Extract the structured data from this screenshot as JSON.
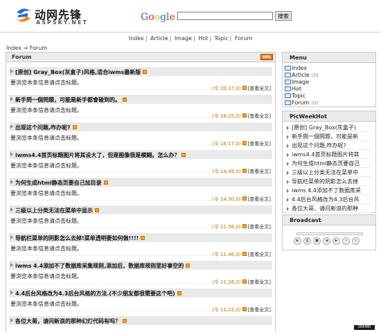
{
  "site": {
    "logo_cn": "动网先锋",
    "logo_en": "ASPSKY.NET"
  },
  "search": {
    "engine_label": "Google",
    "input_value": "",
    "button_label": "搜索"
  },
  "topnav": [
    "Index",
    "Article",
    "Image",
    "Hot",
    "Topic",
    "Forum"
  ],
  "breadcrumb": {
    "home": "Index",
    "arrow": "→",
    "current": "Forum"
  },
  "forum": {
    "title": "Forum",
    "xml_badge": "XML",
    "posts": [
      {
        "title": "[原创] Gray_Box(灰盒子)风格,适合iwms最新版",
        "body": "要浏览本条信息请点击标题。",
        "time": "(今 20:37,0)",
        "action": "[查看全文]"
      },
      {
        "title": "新手問一個問題，可能是新手都會碰到的。",
        "body": "要浏览本条信息请点击标题。",
        "time": "(今 16:25,0)",
        "action": "[查看全文]"
      },
      {
        "title": "出现这个问题,咋办呢?",
        "body": "要浏览本条信息请点击标题。",
        "time": "(今 16:17,0)",
        "action": "[查看全文]"
      },
      {
        "title": "iwms4.4首页标题图片将其设大了，但是图像很是模糊。怎么办？",
        "body": "要浏览本条信息请点击标题。",
        "time": "(今 14:49,0)",
        "action": "[查看全文]"
      },
      {
        "title": "为何生成html静态页要自己加目录",
        "body": "要浏览本条信息请点击标题。",
        "time": "(今 14:30,0)",
        "action": "[查看全文]"
      },
      {
        "title": "三级以上分类无法在菜单中显示",
        "body": "要浏览本条信息请点击标题。",
        "time": "(今 11:56,0)",
        "action": "[查看全文]"
      },
      {
        "title": "导航栏菜单的阴影怎么去掉!菜单透明要如何做!!!!",
        "body": "要浏览本条信息请点击标题。",
        "time": "(今 11:46,0)",
        "action": "[查看全文]"
      },
      {
        "title": "iwms 4.4添加不了数据库采集规则,添加后，数据库规则里好事空的",
        "body": "要浏览本条信息请点击标题。",
        "time": "(今 11:26,0)",
        "action": "[查看全文]"
      },
      {
        "title": "4.4后台风格改为4.3后台风格的方法.(不少朋友都很需要这个吧)",
        "body": "要浏览本条信息请点击标题。",
        "time": "(今 11:22,0)",
        "action": "[查看全文]"
      },
      {
        "title": "各位大哥，请问新浪的那种幻灯代码有吗？",
        "body": "",
        "time": "",
        "action": ""
      }
    ]
  },
  "menu": {
    "title": "Menu",
    "items": [
      {
        "label": "Index",
        "count": ""
      },
      {
        "label": "Article",
        "count": "(0)"
      },
      {
        "label": "Image",
        "count": ""
      },
      {
        "label": "Hot",
        "count": ""
      },
      {
        "label": "Topic",
        "count": ""
      },
      {
        "label": "Forum",
        "count": "(0)"
      }
    ]
  },
  "picweekhot": {
    "title": "PicWeekHot",
    "items": [
      "[原创] Gray_Box(灰盒子)",
      "新手問一個問題，可能是新",
      "出现这个问题,咋办呢?",
      "iwms4.4首页标题图片将其",
      "为何生成html静态页要自己",
      "三级以上分类无法在菜单中",
      "导航栏菜单的阴影怎么去掉",
      "iwms 4.4添加不了数据库采",
      "4.4后台风格改为4.3后台风",
      "各位大哥，请问新浪的那种"
    ]
  },
  "broadcast": {
    "title": "Broadcast"
  },
  "colors": {
    "xml_badge": "#f07a20",
    "time_text": "#b57a00",
    "folder_border": "#4a6ea8"
  },
  "icons": {
    "logo": "aspsky-swirl-icon",
    "folder": "folder-icon",
    "rss": "rss-icon",
    "bullet": "arrow-bullet-icon"
  },
  "watermark": "SINIMEI"
}
